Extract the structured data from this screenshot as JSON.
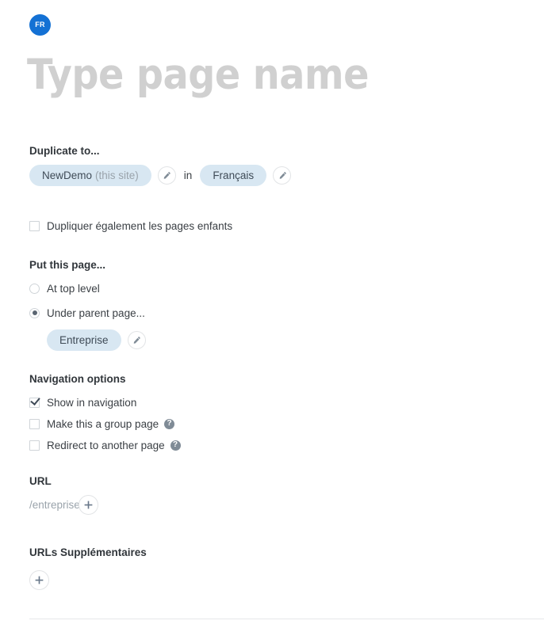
{
  "language_badge": {
    "label": "FR",
    "color": "#1471d4",
    "icon": "language-badge-icon"
  },
  "title": {
    "placeholder": "Type page name",
    "color": "#d0d0d0"
  },
  "duplicate_to": {
    "heading": "Duplicate to...",
    "site_pill": {
      "name": "NewDemo",
      "note": "(this site)"
    },
    "edit_site_icon": "pencil-icon",
    "conjunction": "in",
    "language_pill": {
      "name": "Français"
    },
    "edit_language_icon": "pencil-icon",
    "children_checkbox": {
      "label": "Dupliquer également les pages enfants",
      "checked": false
    }
  },
  "put_this_page": {
    "heading": "Put this page...",
    "options": [
      {
        "label": "At top level",
        "selected": false
      },
      {
        "label": "Under parent page...",
        "selected": true
      }
    ],
    "parent_pill": {
      "name": "Entreprise"
    },
    "edit_parent_icon": "pencil-icon"
  },
  "navigation_options": {
    "heading": "Navigation options",
    "items": [
      {
        "label": "Show in navigation",
        "checked": true,
        "help": false
      },
      {
        "label": "Make this a group page",
        "checked": false,
        "help": true,
        "help_icon": "help-circle-icon"
      },
      {
        "label": "Redirect to another page",
        "checked": false,
        "help": true,
        "help_icon": "help-circle-icon"
      }
    ]
  },
  "url": {
    "heading": "URL",
    "value": "/entreprise/",
    "add_icon": "plus-icon"
  },
  "extra_urls": {
    "heading": "URLs Supplémentaires",
    "add_icon": "plus-icon"
  },
  "colors": {
    "pill_bg": "#d8e7f2",
    "accent_blue": "#1471d4",
    "text": "#3a3f44",
    "muted": "#9aa3ab"
  }
}
